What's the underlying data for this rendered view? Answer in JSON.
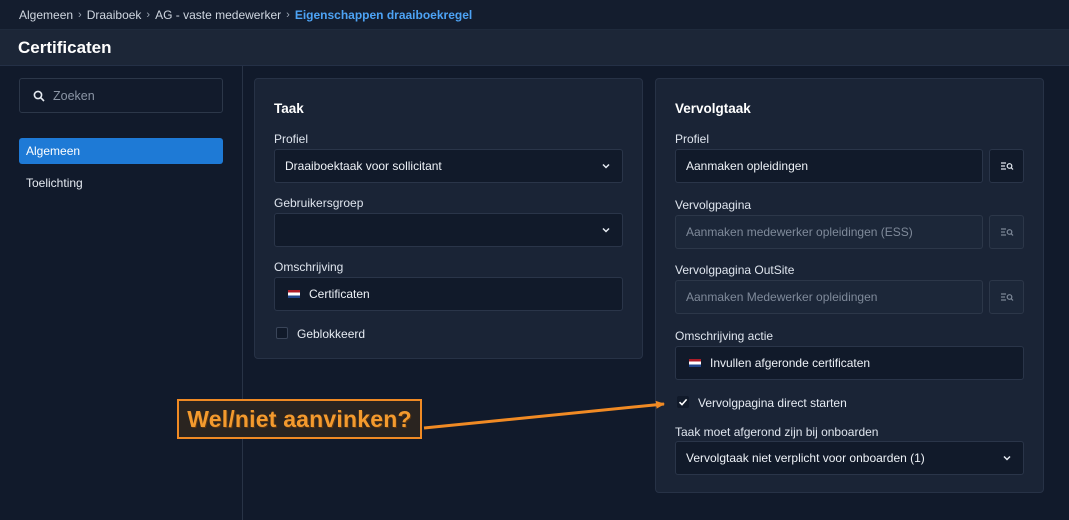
{
  "breadcrumb": {
    "items": [
      "Algemeen",
      "Draaiboek",
      "AG - vaste medewerker"
    ],
    "current": "Eigenschappen draaiboekregel",
    "separator": "›"
  },
  "page": {
    "title": "Certificaten"
  },
  "sidebar": {
    "search_placeholder": "Zoeken",
    "items": [
      {
        "label": "Algemeen",
        "active": true
      },
      {
        "label": "Toelichting",
        "active": false
      }
    ]
  },
  "taak": {
    "heading": "Taak",
    "profiel_label": "Profiel",
    "profiel_value": "Draaiboektaak voor sollicitant",
    "gebruikersgroep_label": "Gebruikersgroep",
    "gebruikersgroep_value": "",
    "omschrijving_label": "Omschrijving",
    "omschrijving_value": "Certificaten",
    "geblokkeerd_label": "Geblokkeerd",
    "geblokkeerd_checked": false
  },
  "vervolgtaak": {
    "heading": "Vervolgtaak",
    "profiel_label": "Profiel",
    "profiel_value": "Aanmaken opleidingen",
    "vervolgpagina_label": "Vervolgpagina",
    "vervolgpagina_value": "Aanmaken medewerker opleidingen (ESS)",
    "outsite_label": "Vervolgpagina OutSite",
    "outsite_value": "Aanmaken Medewerker opleidingen",
    "actie_label": "Omschrijving actie",
    "actie_value": "Invullen afgeronde certificaten",
    "direct_label": "Vervolgpagina direct starten",
    "direct_checked": true,
    "onboarden_label": "Taak moet afgerond zijn bij onboarden",
    "onboarden_value": "Vervolgtaak niet verplicht voor onboarden (1)"
  },
  "annotation": {
    "text": "Wel/niet aanvinken?"
  },
  "colors": {
    "accent": "#1e7ad6",
    "link": "#4da3f5",
    "annotation": "#f08a24",
    "background": "#111a2b",
    "panel": "#1a2436"
  },
  "icons": [
    "search-icon",
    "chevron-down-icon",
    "lookup-icon",
    "flag-nl-icon",
    "checkmark-icon",
    "arrow-icon"
  ]
}
